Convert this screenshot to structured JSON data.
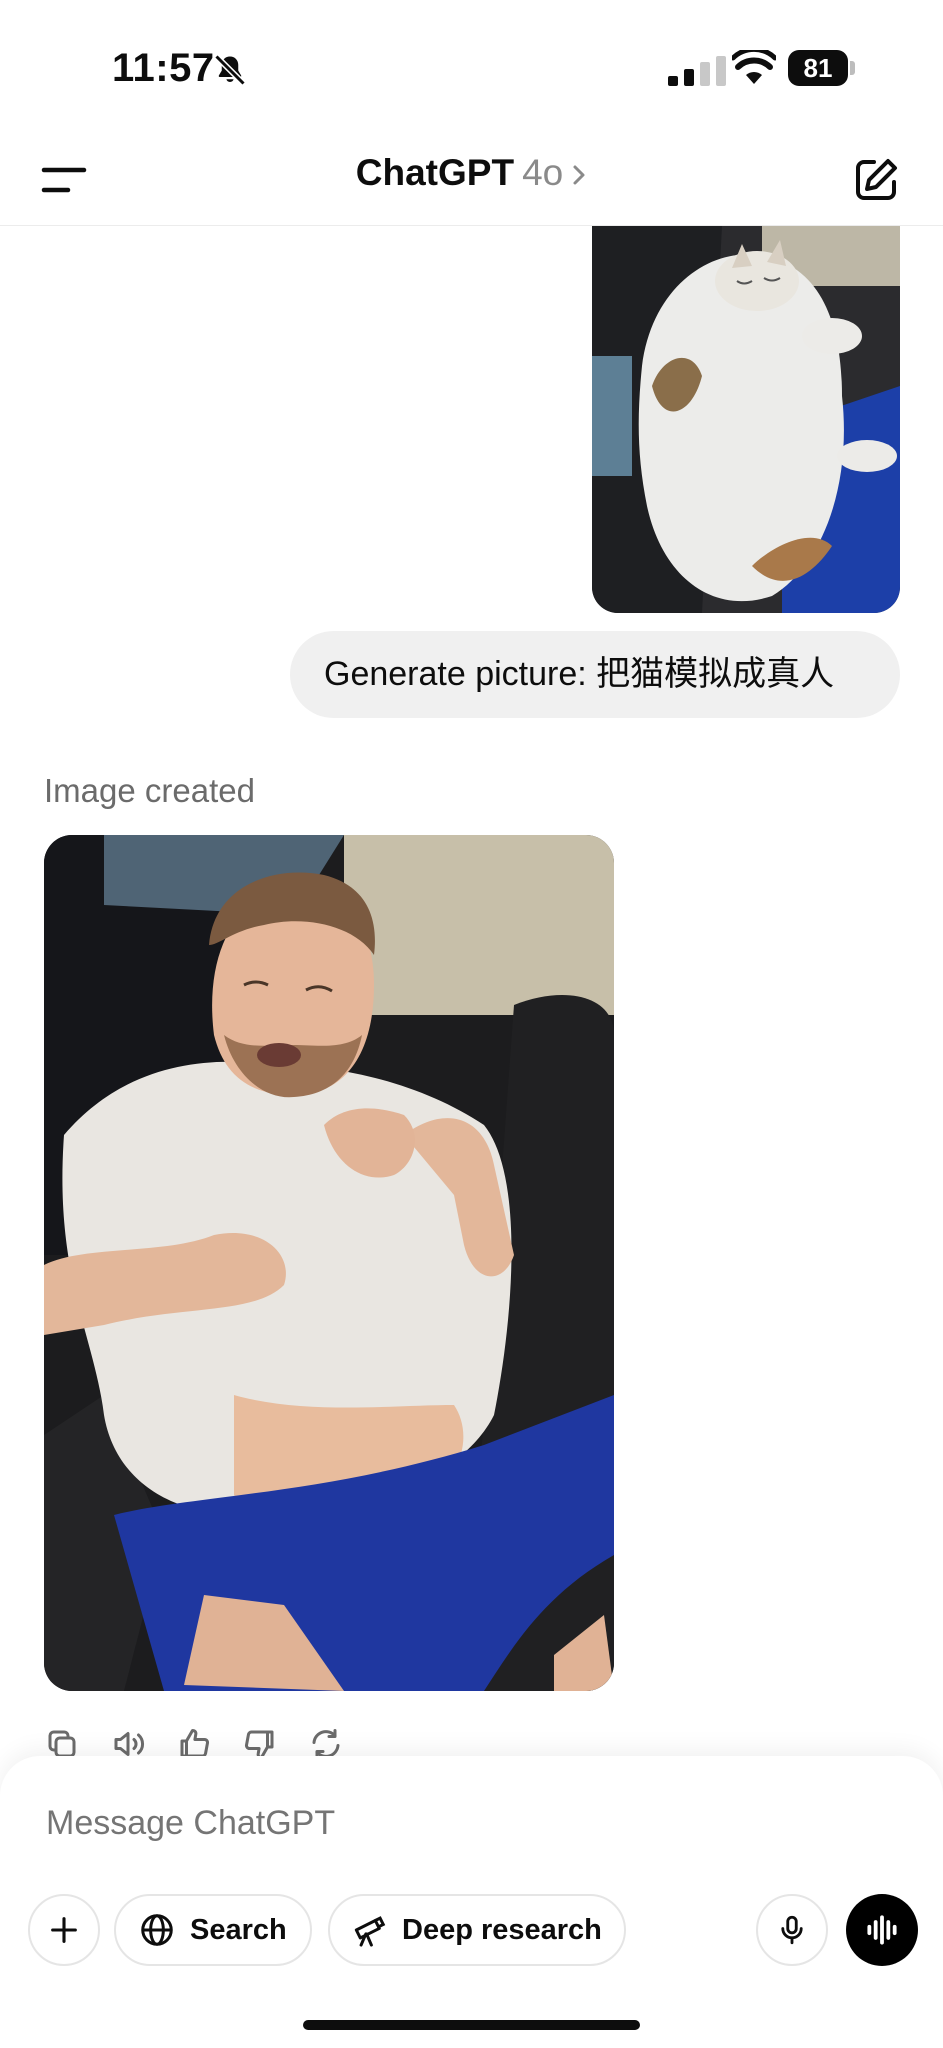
{
  "status_bar": {
    "time": "11:57",
    "battery": "81"
  },
  "header": {
    "title": "ChatGPT",
    "model": "4o"
  },
  "conversation": {
    "user_message": "Generate picture: 把猫模拟成真人",
    "assistant_status": "Image created"
  },
  "composer": {
    "placeholder": "Message ChatGPT",
    "search_label": "Search",
    "deep_research_label": "Deep research"
  },
  "colors": {
    "accent": "#0d0d0d",
    "bubble": "#f0f0f0",
    "muted": "#8e8e8e"
  },
  "icons": {
    "status": [
      "bell-slash-icon",
      "signal-icon",
      "wifi-icon",
      "battery-icon"
    ],
    "header": [
      "menu-icon",
      "chevron-right-icon",
      "new-chat-icon"
    ],
    "actions": [
      "copy-icon",
      "read-aloud-icon",
      "thumbs-up-icon",
      "thumbs-down-icon",
      "regenerate-icon"
    ],
    "composer": [
      "plus-icon",
      "globe-icon",
      "telescope-icon",
      "microphone-icon",
      "voice-mode-icon"
    ]
  }
}
